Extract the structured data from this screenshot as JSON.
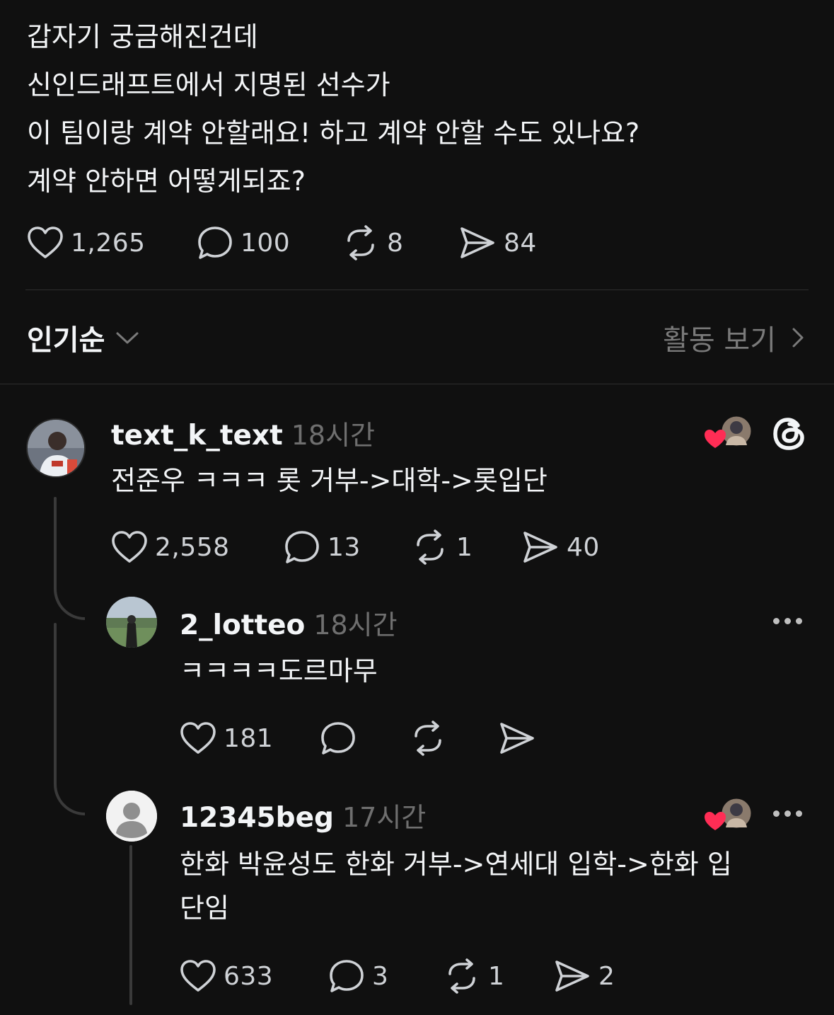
{
  "post": {
    "lines": [
      "갑자기 궁금해진건데",
      "신인드래프트에서 지명된 선수가",
      "이 팀이랑 계약 안할래요! 하고 계약 안할 수도 있나요?",
      "계약 안하면 어떻게되죠?"
    ],
    "likes": "1,265",
    "comments": "100",
    "reposts": "8",
    "shares": "84"
  },
  "sort": {
    "label": "인기순",
    "activity_label": "활동 보기"
  },
  "replies": [
    {
      "username": "text_k_text",
      "time": "18시간",
      "text": "전준우 ㅋㅋㅋ 롯 거부->대학->롯입단",
      "likes": "2,558",
      "comments": "13",
      "reposts": "1",
      "shares": "40"
    },
    {
      "username": "2_lotteo",
      "time": "18시간",
      "text": "ㅋㅋㅋㅋ도르마무",
      "likes": "181"
    },
    {
      "username": "12345beg",
      "time": "17시간",
      "text_lines": [
        "한화 박윤성도 한화 거부->연세대 입학->한화 입",
        "단임"
      ],
      "likes": "633",
      "comments": "3",
      "reposts": "1",
      "shares": "2"
    }
  ],
  "icons": {
    "like": "heart-outline-icon",
    "comment": "speech-bubble-icon",
    "repost": "repost-arrows-icon",
    "share": "paper-plane-icon",
    "threads": "threads-logo-icon",
    "more": "more-dots-icon",
    "chevron_down": "chevron-down-icon",
    "chevron_right": "chevron-right-icon"
  },
  "colors": {
    "background": "#101010",
    "text": "#f3f5f7",
    "secondary": "#6f6f6f",
    "heart_red": "#ff2d55"
  }
}
